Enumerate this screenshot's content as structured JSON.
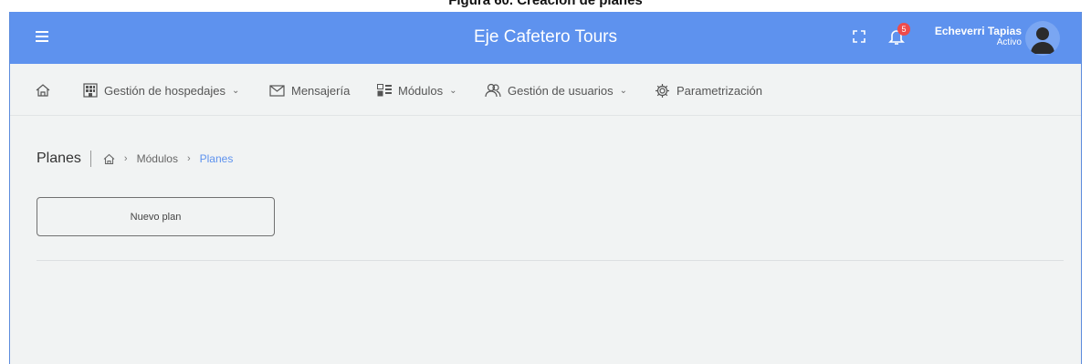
{
  "caption": "Figura 60. Creación de planes",
  "topbar": {
    "title": "Eje Cafetero Tours",
    "notification_count": "5",
    "user_name": "Echeverri Tapias",
    "user_status": "Activo",
    "colors": {
      "bar": "#5e92ee",
      "badge": "#ef4b4b"
    }
  },
  "nav": {
    "home_icon": "home-icon",
    "items": [
      {
        "label": "Gestión de hospedajes",
        "icon": "building-icon",
        "has_dropdown": true
      },
      {
        "label": "Mensajería",
        "icon": "envelope-icon",
        "has_dropdown": false
      },
      {
        "label": "Módulos",
        "icon": "modules-icon",
        "has_dropdown": true
      },
      {
        "label": "Gestión de usuarios",
        "icon": "users-icon",
        "has_dropdown": true
      },
      {
        "label": "Parametrización",
        "icon": "gear-icon",
        "has_dropdown": false
      }
    ]
  },
  "breadcrumb": {
    "title": "Planes",
    "items": [
      "Módulos",
      "Planes"
    ]
  },
  "actions": {
    "new_plan": "Nuevo plan"
  }
}
